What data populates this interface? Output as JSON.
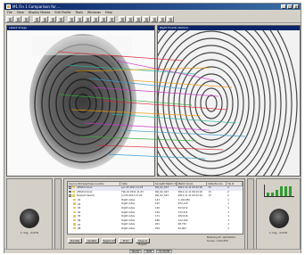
{
  "window": {
    "title": "M1 Fin 1 Comparison for ...",
    "controls": [
      "_",
      "□",
      "×"
    ]
  },
  "menu": [
    "File",
    "View",
    "Display Modes",
    "Edit Profile",
    "Tools",
    "Windows",
    "Help"
  ],
  "panes": {
    "left_title": "Latent Image",
    "right_title": "Right Thumb (Rolled)"
  },
  "sides": {
    "left_caption": "L ring - 0.979",
    "right_caption": "L ring - 0.979"
  },
  "table": {
    "headers": [
      "Source ID/Case/Class location",
      "Date",
      "Score/ID Match Tip",
      "Match Score",
      "Date/Source",
      "Tip #"
    ],
    "rows": [
      {
        "indent": 0,
        "toggle": true,
        "folder": true,
        "cells": [
          "AFIS/Criminal",
          "Jan 15 2011 11:23",
          "Pat_02_013",
          "2011.11.11 09:12:10",
          "13",
          "2"
        ]
      },
      {
        "indent": 0,
        "toggle": true,
        "folder": true,
        "cells": [
          "AFIS/Criminal",
          "Feb 22 2011 11:23",
          "Pat_02_013",
          "2011.11.11 09:12:10",
          "13",
          "2"
        ]
      },
      {
        "indent": 0,
        "toggle": true,
        "folder": true,
        "cells": [
          "Suspect Search",
          "Jul 04 2011 11:23",
          "Pat_02_013",
          "2011.11.11 09:12:10",
          "13",
          "2"
        ]
      },
      {
        "indent": 1,
        "toggle": false,
        "folder": true,
        "cells": [
          "01",
          "Right index",
          "123",
          "1,102,050",
          "",
          "1"
        ]
      },
      {
        "indent": 1,
        "toggle": false,
        "folder": true,
        "cells": [
          "02",
          "Right index",
          "125",
          "872,123",
          "",
          "1"
        ]
      },
      {
        "indent": 1,
        "toggle": false,
        "folder": true,
        "cells": [
          "03",
          "Right index",
          "140",
          "813,012",
          "",
          "1"
        ]
      },
      {
        "indent": 1,
        "toggle": false,
        "folder": true,
        "cells": [
          "04",
          "Right index",
          "156",
          "372,311",
          "",
          "1"
        ]
      },
      {
        "indent": 1,
        "toggle": false,
        "folder": true,
        "cells": [
          "05",
          "Right index",
          "171",
          "182,014",
          "",
          "1"
        ]
      },
      {
        "indent": 1,
        "toggle": false,
        "folder": true,
        "cells": [
          "06",
          "Right index",
          "186",
          "122,104",
          "",
          "1"
        ]
      },
      {
        "indent": 1,
        "toggle": false,
        "folder": true,
        "cells": [
          "07",
          "Right index",
          "201",
          "98,732",
          "",
          "1"
        ]
      },
      {
        "indent": 1,
        "toggle": false,
        "folder": true,
        "cells": [
          "08",
          "Right index",
          "224",
          "91,002",
          "",
          "1"
        ]
      }
    ]
  },
  "buttons": [
    "Identify",
    "Update",
    "Reject All",
    "Print",
    "Save & Export"
  ],
  "status_right": [
    "Matching ID: 10/13/2011",
    "Scores: 1,102,050"
  ],
  "statusbar": [
    "Ready",
    "NUM",
    "12:40 PM"
  ],
  "mini_chart": {
    "values": [
      0.3,
      0.3,
      0.55,
      0.85,
      0.85,
      0.85
    ],
    "color": "#2e9b2e"
  }
}
